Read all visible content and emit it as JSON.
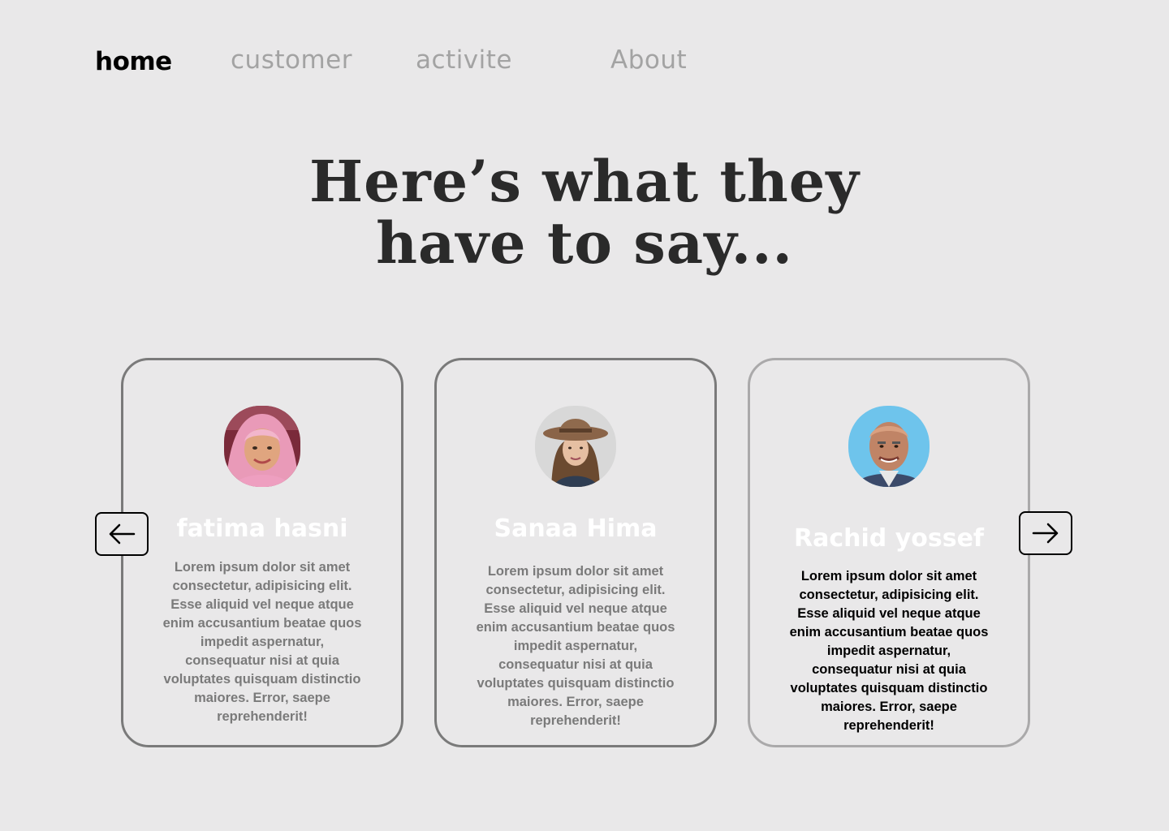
{
  "nav": {
    "items": [
      {
        "label": "home",
        "active": true
      },
      {
        "label": "customer",
        "active": false
      },
      {
        "label": "activite",
        "active": false
      },
      {
        "label": "About",
        "active": false
      }
    ]
  },
  "hero": {
    "title_line1": "Here’s what they",
    "title_line2": "have to say..."
  },
  "carousel": {
    "prev_icon": "arrow-left-icon",
    "next_icon": "arrow-right-icon"
  },
  "testimonials": [
    {
      "name": "fatima hasni",
      "avatar": "woman-in-pink-hijab-photo",
      "text": "Lorem ipsum dolor sit amet consectetur, adipisicing elit. Esse aliquid vel neque atque enim accusantium beatae quos impedit aspernatur, consequatur nisi at quia voluptates quisquam distinctio maiores. Error, saepe reprehenderit!"
    },
    {
      "name": "Sanaa Hima",
      "avatar": "woman-in-brown-hat-photo",
      "text": "Lorem ipsum dolor sit amet consectetur, adipisicing elit. Esse aliquid vel neque atque enim accusantium beatae quos impedit aspernatur, consequatur nisi at quia voluptates quisquam distinctio maiores. Error, saepe reprehenderit!"
    },
    {
      "name": "Rachid yossef",
      "avatar": "man-on-blue-background-photo",
      "text": "Lorem ipsum dolor sit amet consectetur, adipisicing elit. Esse aliquid vel neque atque enim accusantium beatae quos impedit aspernatur, consequatur nisi at quia voluptates quisquam distinctio maiores. Error, saepe reprehenderit!"
    }
  ],
  "colors": {
    "background": "#e9e8e9",
    "heading": "#2a2a2a",
    "nav_inactive": "#a3a3a3",
    "card_border": "#7a7a7a",
    "card_border_faded": "#aaa9aa",
    "avatar_blue": "#6ec4ec"
  }
}
